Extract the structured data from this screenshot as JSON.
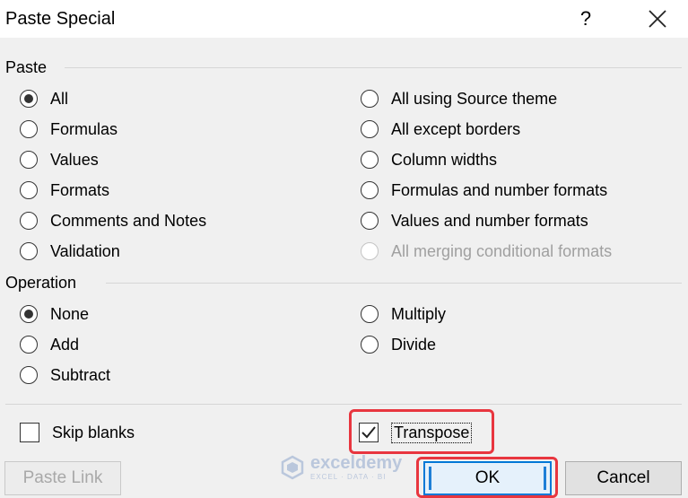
{
  "dialog": {
    "title": "Paste Special",
    "help_label": "?"
  },
  "paste": {
    "label": "Paste",
    "left": [
      {
        "label": "All",
        "checked": true
      },
      {
        "label": "Formulas",
        "checked": false
      },
      {
        "label": "Values",
        "checked": false
      },
      {
        "label": "Formats",
        "checked": false
      },
      {
        "label": "Comments and Notes",
        "checked": false
      },
      {
        "label": "Validation",
        "checked": false
      }
    ],
    "right": [
      {
        "label": "All using Source theme",
        "checked": false
      },
      {
        "label": "All except borders",
        "checked": false
      },
      {
        "label": "Column widths",
        "checked": false
      },
      {
        "label": "Formulas and number formats",
        "checked": false
      },
      {
        "label": "Values and number formats",
        "checked": false
      },
      {
        "label": "All merging conditional formats",
        "checked": false,
        "disabled": true
      }
    ]
  },
  "operation": {
    "label": "Operation",
    "left": [
      {
        "label": "None",
        "checked": true
      },
      {
        "label": "Add",
        "checked": false
      },
      {
        "label": "Subtract",
        "checked": false
      }
    ],
    "right": [
      {
        "label": "Multiply",
        "checked": false
      },
      {
        "label": "Divide",
        "checked": false
      }
    ]
  },
  "options": {
    "skip_blanks": {
      "label": "Skip blanks",
      "checked": false
    },
    "transpose": {
      "label": "Transpose",
      "checked": true
    }
  },
  "buttons": {
    "paste_link": "Paste Link",
    "ok": "OK",
    "cancel": "Cancel"
  },
  "watermark": {
    "name": "exceldemy",
    "tagline": "EXCEL · DATA · BI"
  },
  "colors": {
    "highlight": "#e8363f",
    "focus": "#0078d7"
  }
}
